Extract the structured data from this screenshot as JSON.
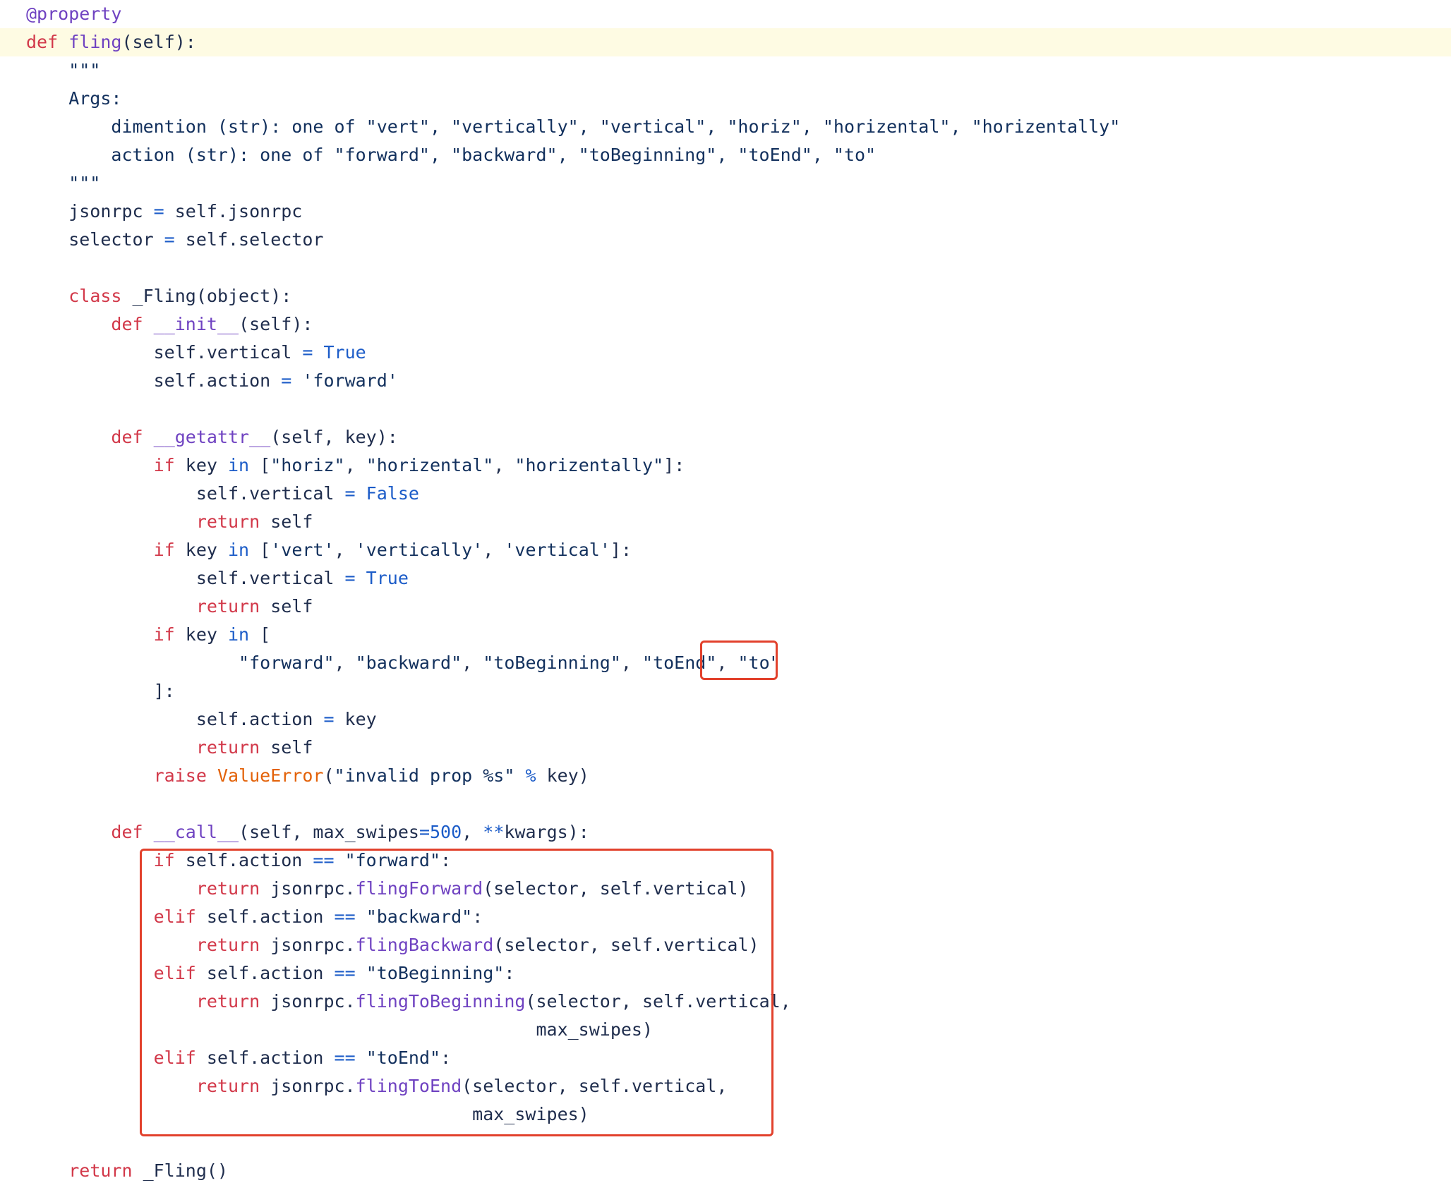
{
  "colors": {
    "keyword": "#d23849",
    "function": "#6f42c1",
    "string": "#12305d",
    "number": "#1c5cc8",
    "class": "#e36209",
    "highlight_line": "#fefbe3",
    "annotation_box": "#e2412c"
  },
  "lines": [
    [
      {
        "t": "@property",
        "c": "deco"
      }
    ],
    [
      {
        "t": "def",
        "c": "def"
      },
      {
        "t": " ",
        "c": "plain"
      },
      {
        "t": "fling",
        "c": "fn"
      },
      {
        "t": "(self):",
        "c": "plain"
      }
    ],
    [
      {
        "t": "    \"\"\"",
        "c": "doc"
      }
    ],
    [
      {
        "t": "    Args:",
        "c": "doc"
      }
    ],
    [
      {
        "t": "        dimention (str): one of \"vert\", \"vertically\", \"vertical\", \"horiz\", \"horizental\", \"horizentally\"",
        "c": "doc"
      }
    ],
    [
      {
        "t": "        action (str): one of \"forward\", \"backward\", \"toBeginning\", \"toEnd\", \"to\"",
        "c": "doc"
      }
    ],
    [
      {
        "t": "    \"\"\"",
        "c": "doc"
      }
    ],
    [
      {
        "t": "    jsonrpc ",
        "c": "plain"
      },
      {
        "t": "=",
        "c": "op"
      },
      {
        "t": " self.jsonrpc",
        "c": "plain"
      }
    ],
    [
      {
        "t": "    selector ",
        "c": "plain"
      },
      {
        "t": "=",
        "c": "op"
      },
      {
        "t": " self.selector",
        "c": "plain"
      }
    ],
    [
      {
        "t": "",
        "c": "plain"
      }
    ],
    [
      {
        "t": "    ",
        "c": "plain"
      },
      {
        "t": "class",
        "c": "kw"
      },
      {
        "t": " _Fling(object):",
        "c": "plain"
      }
    ],
    [
      {
        "t": "        ",
        "c": "plain"
      },
      {
        "t": "def",
        "c": "def"
      },
      {
        "t": " ",
        "c": "plain"
      },
      {
        "t": "__init__",
        "c": "dunder"
      },
      {
        "t": "(self):",
        "c": "plain"
      }
    ],
    [
      {
        "t": "            self.vertical ",
        "c": "plain"
      },
      {
        "t": "=",
        "c": "op"
      },
      {
        "t": " ",
        "c": "plain"
      },
      {
        "t": "True",
        "c": "bool"
      }
    ],
    [
      {
        "t": "            self.action ",
        "c": "plain"
      },
      {
        "t": "=",
        "c": "op"
      },
      {
        "t": " ",
        "c": "plain"
      },
      {
        "t": "'forward'",
        "c": "str"
      }
    ],
    [
      {
        "t": "",
        "c": "plain"
      }
    ],
    [
      {
        "t": "        ",
        "c": "plain"
      },
      {
        "t": "def",
        "c": "def"
      },
      {
        "t": " ",
        "c": "plain"
      },
      {
        "t": "__getattr__",
        "c": "dunder"
      },
      {
        "t": "(self, key):",
        "c": "plain"
      }
    ],
    [
      {
        "t": "            ",
        "c": "plain"
      },
      {
        "t": "if",
        "c": "kw"
      },
      {
        "t": " key ",
        "c": "plain"
      },
      {
        "t": "in",
        "c": "op"
      },
      {
        "t": " [",
        "c": "plain"
      },
      {
        "t": "\"horiz\"",
        "c": "str"
      },
      {
        "t": ", ",
        "c": "plain"
      },
      {
        "t": "\"horizental\"",
        "c": "str"
      },
      {
        "t": ", ",
        "c": "plain"
      },
      {
        "t": "\"horizentally\"",
        "c": "str"
      },
      {
        "t": "]:",
        "c": "plain"
      }
    ],
    [
      {
        "t": "                self.vertical ",
        "c": "plain"
      },
      {
        "t": "=",
        "c": "op"
      },
      {
        "t": " ",
        "c": "plain"
      },
      {
        "t": "False",
        "c": "bool"
      }
    ],
    [
      {
        "t": "                ",
        "c": "plain"
      },
      {
        "t": "return",
        "c": "kw"
      },
      {
        "t": " self",
        "c": "plain"
      }
    ],
    [
      {
        "t": "            ",
        "c": "plain"
      },
      {
        "t": "if",
        "c": "kw"
      },
      {
        "t": " key ",
        "c": "plain"
      },
      {
        "t": "in",
        "c": "op"
      },
      {
        "t": " [",
        "c": "plain"
      },
      {
        "t": "'vert'",
        "c": "str"
      },
      {
        "t": ", ",
        "c": "plain"
      },
      {
        "t": "'vertically'",
        "c": "str"
      },
      {
        "t": ", ",
        "c": "plain"
      },
      {
        "t": "'vertical'",
        "c": "str"
      },
      {
        "t": "]:",
        "c": "plain"
      }
    ],
    [
      {
        "t": "                self.vertical ",
        "c": "plain"
      },
      {
        "t": "=",
        "c": "op"
      },
      {
        "t": " ",
        "c": "plain"
      },
      {
        "t": "True",
        "c": "bool"
      }
    ],
    [
      {
        "t": "                ",
        "c": "plain"
      },
      {
        "t": "return",
        "c": "kw"
      },
      {
        "t": " self",
        "c": "plain"
      }
    ],
    [
      {
        "t": "            ",
        "c": "plain"
      },
      {
        "t": "if",
        "c": "kw"
      },
      {
        "t": " key ",
        "c": "plain"
      },
      {
        "t": "in",
        "c": "op"
      },
      {
        "t": " [",
        "c": "plain"
      }
    ],
    [
      {
        "t": "                    ",
        "c": "plain"
      },
      {
        "t": "\"forward\"",
        "c": "str"
      },
      {
        "t": ", ",
        "c": "plain"
      },
      {
        "t": "\"backward\"",
        "c": "str"
      },
      {
        "t": ", ",
        "c": "plain"
      },
      {
        "t": "\"toBeginning\"",
        "c": "str"
      },
      {
        "t": ", ",
        "c": "plain"
      },
      {
        "t": "\"toEnd\"",
        "c": "str"
      },
      {
        "t": ", ",
        "c": "plain"
      },
      {
        "t": "\"to\"",
        "c": "str"
      }
    ],
    [
      {
        "t": "            ]:",
        "c": "plain"
      }
    ],
    [
      {
        "t": "                self.action ",
        "c": "plain"
      },
      {
        "t": "=",
        "c": "op"
      },
      {
        "t": " key",
        "c": "plain"
      }
    ],
    [
      {
        "t": "                ",
        "c": "plain"
      },
      {
        "t": "return",
        "c": "kw"
      },
      {
        "t": " self",
        "c": "plain"
      }
    ],
    [
      {
        "t": "            ",
        "c": "plain"
      },
      {
        "t": "raise",
        "c": "kw"
      },
      {
        "t": " ",
        "c": "plain"
      },
      {
        "t": "ValueError",
        "c": "cls"
      },
      {
        "t": "(",
        "c": "plain"
      },
      {
        "t": "\"invalid prop %s\"",
        "c": "str"
      },
      {
        "t": " ",
        "c": "plain"
      },
      {
        "t": "%",
        "c": "op"
      },
      {
        "t": " key)",
        "c": "plain"
      }
    ],
    [
      {
        "t": "",
        "c": "plain"
      }
    ],
    [
      {
        "t": "        ",
        "c": "plain"
      },
      {
        "t": "def",
        "c": "def"
      },
      {
        "t": " ",
        "c": "plain"
      },
      {
        "t": "__call__",
        "c": "dunder"
      },
      {
        "t": "(self, max_swipes",
        "c": "plain"
      },
      {
        "t": "=",
        "c": "op"
      },
      {
        "t": "500",
        "c": "num"
      },
      {
        "t": ", ",
        "c": "plain"
      },
      {
        "t": "**",
        "c": "op"
      },
      {
        "t": "kwargs):",
        "c": "plain"
      }
    ],
    [
      {
        "t": "            ",
        "c": "plain"
      },
      {
        "t": "if",
        "c": "kw"
      },
      {
        "t": " self.action ",
        "c": "plain"
      },
      {
        "t": "==",
        "c": "op"
      },
      {
        "t": " ",
        "c": "plain"
      },
      {
        "t": "\"forward\"",
        "c": "str"
      },
      {
        "t": ":",
        "c": "plain"
      }
    ],
    [
      {
        "t": "                ",
        "c": "plain"
      },
      {
        "t": "return",
        "c": "kw"
      },
      {
        "t": " jsonrpc.",
        "c": "plain"
      },
      {
        "t": "flingForward",
        "c": "fn"
      },
      {
        "t": "(selector, self.vertical)",
        "c": "plain"
      }
    ],
    [
      {
        "t": "            ",
        "c": "plain"
      },
      {
        "t": "elif",
        "c": "kw"
      },
      {
        "t": " self.action ",
        "c": "plain"
      },
      {
        "t": "==",
        "c": "op"
      },
      {
        "t": " ",
        "c": "plain"
      },
      {
        "t": "\"backward\"",
        "c": "str"
      },
      {
        "t": ":",
        "c": "plain"
      }
    ],
    [
      {
        "t": "                ",
        "c": "plain"
      },
      {
        "t": "return",
        "c": "kw"
      },
      {
        "t": " jsonrpc.",
        "c": "plain"
      },
      {
        "t": "flingBackward",
        "c": "fn"
      },
      {
        "t": "(selector, self.vertical)",
        "c": "plain"
      }
    ],
    [
      {
        "t": "            ",
        "c": "plain"
      },
      {
        "t": "elif",
        "c": "kw"
      },
      {
        "t": " self.action ",
        "c": "plain"
      },
      {
        "t": "==",
        "c": "op"
      },
      {
        "t": " ",
        "c": "plain"
      },
      {
        "t": "\"toBeginning\"",
        "c": "str"
      },
      {
        "t": ":",
        "c": "plain"
      }
    ],
    [
      {
        "t": "                ",
        "c": "plain"
      },
      {
        "t": "return",
        "c": "kw"
      },
      {
        "t": " jsonrpc.",
        "c": "plain"
      },
      {
        "t": "flingToBeginning",
        "c": "fn"
      },
      {
        "t": "(selector, self.vertical,",
        "c": "plain"
      }
    ],
    [
      {
        "t": "                                                max_swipes)",
        "c": "plain"
      }
    ],
    [
      {
        "t": "            ",
        "c": "plain"
      },
      {
        "t": "elif",
        "c": "kw"
      },
      {
        "t": " self.action ",
        "c": "plain"
      },
      {
        "t": "==",
        "c": "op"
      },
      {
        "t": " ",
        "c": "plain"
      },
      {
        "t": "\"toEnd\"",
        "c": "str"
      },
      {
        "t": ":",
        "c": "plain"
      }
    ],
    [
      {
        "t": "                ",
        "c": "plain"
      },
      {
        "t": "return",
        "c": "kw"
      },
      {
        "t": " jsonrpc.",
        "c": "plain"
      },
      {
        "t": "flingToEnd",
        "c": "fn"
      },
      {
        "t": "(selector, self.vertical,",
        "c": "plain"
      }
    ],
    [
      {
        "t": "                                          max_swipes)",
        "c": "plain"
      }
    ],
    [
      {
        "t": "",
        "c": "plain"
      }
    ],
    [
      {
        "t": "    ",
        "c": "plain"
      },
      {
        "t": "return",
        "c": "kw"
      },
      {
        "t": " _Fling()",
        "c": "plain"
      }
    ]
  ]
}
